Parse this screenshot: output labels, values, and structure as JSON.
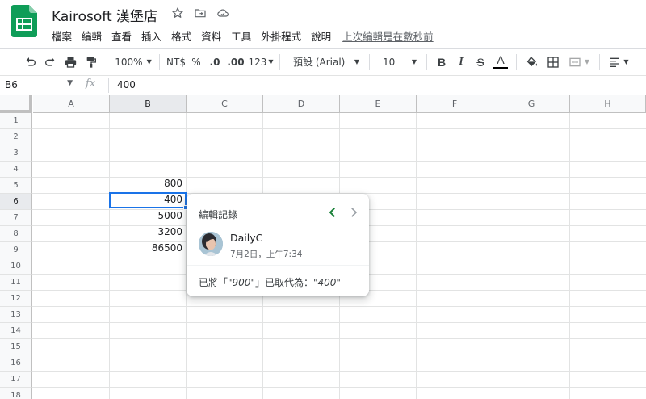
{
  "header": {
    "title": "Kairosoft 漢堡店",
    "menu": [
      "檔案",
      "編輯",
      "查看",
      "插入",
      "格式",
      "資料",
      "工具",
      "外掛程式",
      "說明"
    ],
    "last_edit": "上次編輯是在數秒前"
  },
  "toolbar": {
    "zoom": "100%",
    "currency": "NT$",
    "percent": "%",
    "dec_decrease": ".0",
    "dec_increase": ".00",
    "more_formats": "123",
    "font": "預設 (Arial)",
    "font_size": "10",
    "bold": "B",
    "italic": "I",
    "strike": "S",
    "text_color": "A",
    "text_color_value": "#000000"
  },
  "formula_bar": {
    "cell_ref": "B6",
    "fx": "fx",
    "value": "400"
  },
  "grid": {
    "columns": [
      "A",
      "B",
      "C",
      "D",
      "E",
      "F",
      "G",
      "H"
    ],
    "rows": [
      "1",
      "2",
      "3",
      "4",
      "5",
      "6",
      "7",
      "8",
      "9",
      "10",
      "11",
      "12",
      "13",
      "14",
      "15",
      "16",
      "17",
      "18"
    ],
    "active_column": "B",
    "active_row": "6",
    "cells": {
      "B5": "800",
      "B6": "400",
      "B7": "5000",
      "B8": "3200",
      "B9": "86500"
    }
  },
  "popup": {
    "title": "編輯記錄",
    "user": "DailyC",
    "timestamp": "7月2日，上午7:34",
    "change_prefix": "已將「",
    "old_value": "\"900\"",
    "change_mid": "」已取代為：",
    "new_value": "\"400\""
  },
  "colors": {
    "accent": "#1a73e8",
    "sheets_green": "#0f9d58",
    "nav_active": "#188038"
  }
}
